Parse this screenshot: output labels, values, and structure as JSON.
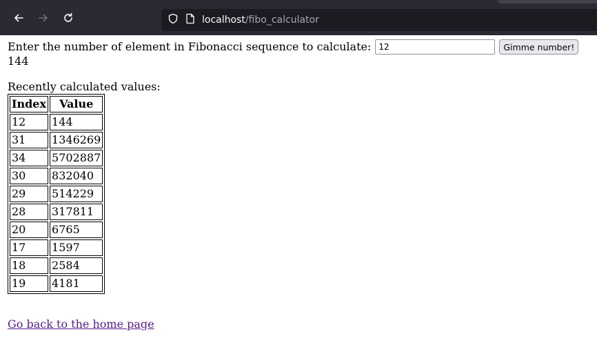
{
  "browser": {
    "url_host": "localhost",
    "url_path": "/fibo_calculator"
  },
  "form": {
    "prompt": "Enter the number of element in Fibonacci sequence to calculate:",
    "input_value": "12",
    "submit_label": "Gimme number!"
  },
  "result": "144",
  "recent": {
    "label": "Recently calculated values:",
    "headers": [
      "Index",
      "Value"
    ],
    "rows": [
      [
        "12",
        "144"
      ],
      [
        "31",
        "1346269"
      ],
      [
        "34",
        "5702887"
      ],
      [
        "30",
        "832040"
      ],
      [
        "29",
        "514229"
      ],
      [
        "28",
        "317811"
      ],
      [
        "20",
        "6765"
      ],
      [
        "17",
        "1597"
      ],
      [
        "18",
        "2584"
      ],
      [
        "19",
        "4181"
      ]
    ]
  },
  "home_link": "Go back to the home page"
}
